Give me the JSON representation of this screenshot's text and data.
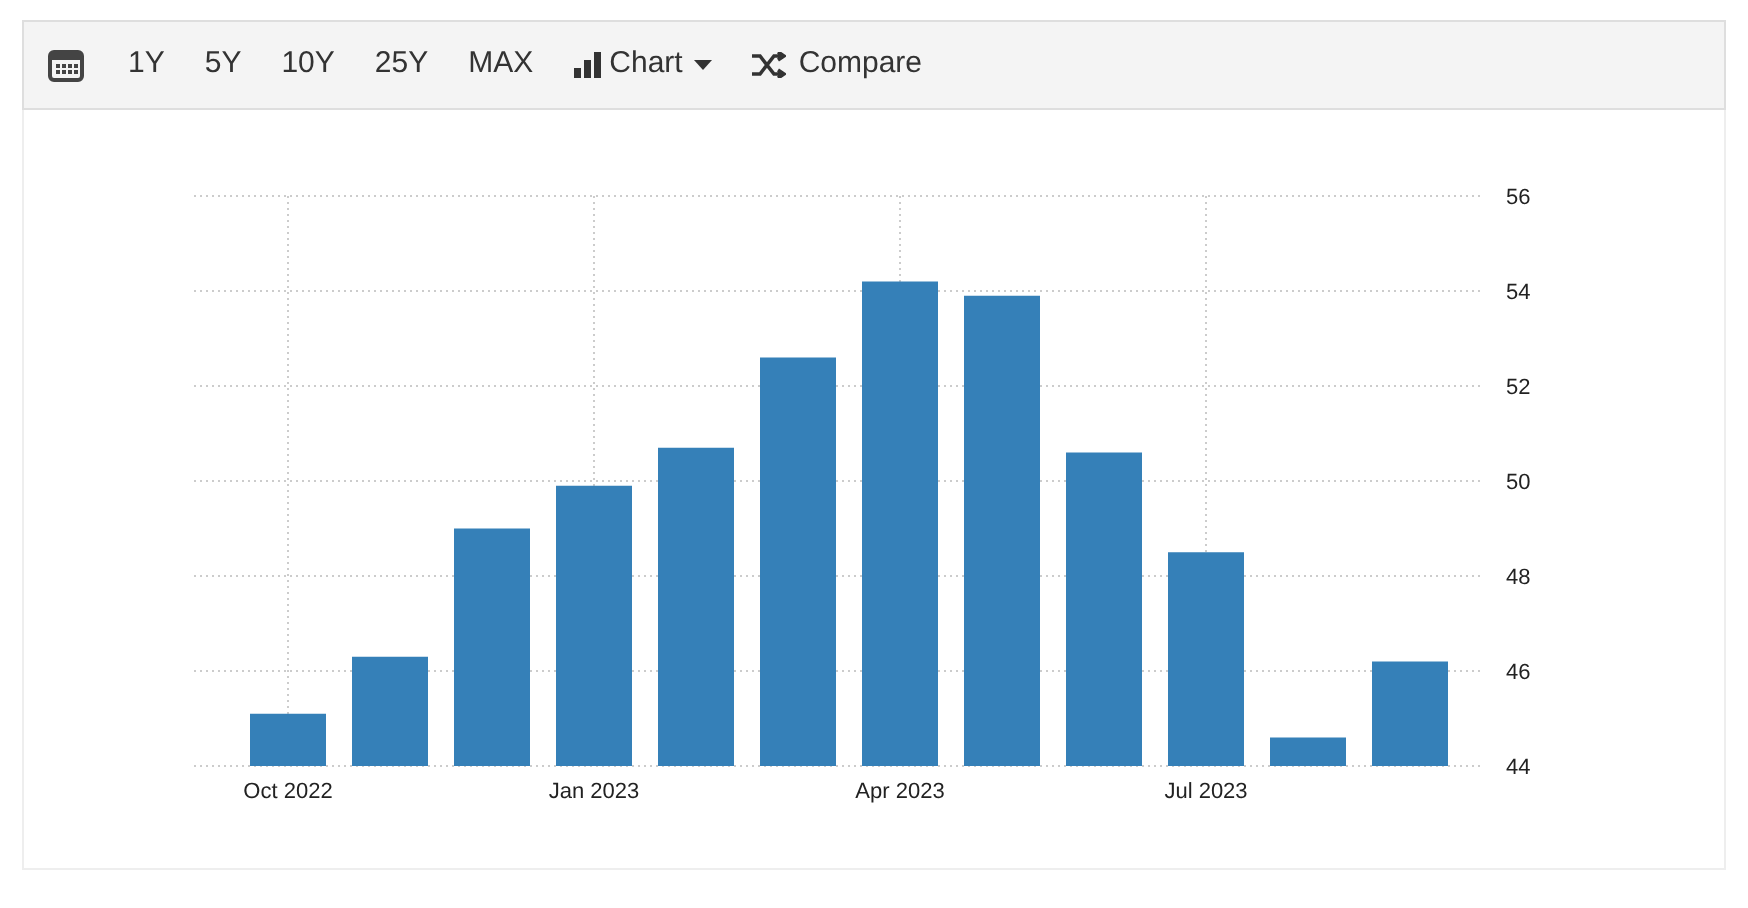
{
  "toolbar": {
    "ranges": [
      {
        "label": "1Y",
        "selected": false
      },
      {
        "label": "5Y",
        "selected": false
      },
      {
        "label": "10Y",
        "selected": false
      },
      {
        "label": "25Y",
        "selected": false
      },
      {
        "label": "MAX",
        "selected": false
      }
    ],
    "chart_menu": "Chart",
    "compare": "Compare"
  },
  "chart": {
    "chart_data": {
      "type": "bar",
      "grid": true,
      "categories": [
        "Oct 2022",
        null,
        null,
        "Jan 2023",
        null,
        null,
        "Apr 2023",
        null,
        null,
        "Jul 2023",
        null,
        null
      ],
      "series": [
        {
          "color": "#3580b8",
          "values": [
            45.1,
            46.3,
            49.0,
            49.9,
            50.7,
            52.6,
            54.2,
            53.9,
            50.6,
            48.5,
            44.6,
            46.2
          ]
        }
      ],
      "ylim": [
        44,
        56
      ],
      "yticks": [
        44,
        46,
        48,
        50,
        52,
        54,
        56
      ]
    }
  }
}
